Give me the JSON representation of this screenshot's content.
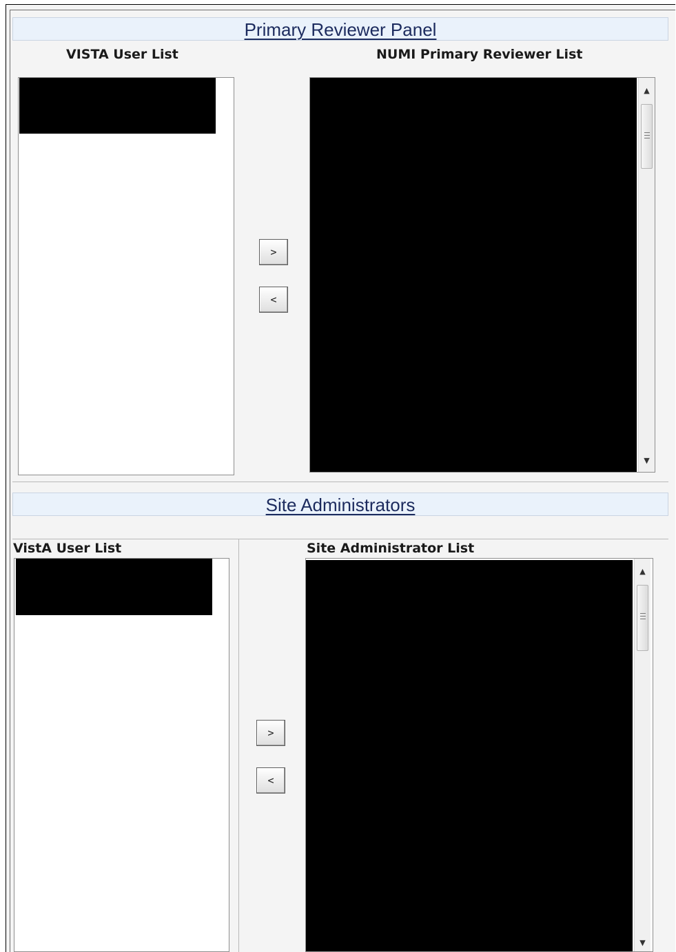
{
  "primary_panel": {
    "title": "Primary Reviewer Panel",
    "left_label": "VISTA User List",
    "right_label": "NUMI Primary Reviewer List",
    "add_button": ">",
    "remove_button": "<"
  },
  "site_admin_panel": {
    "title": "Site Administrators",
    "left_label": "VistA User List",
    "right_label": "Site Administrator List",
    "add_button": ">",
    "remove_button": "<"
  },
  "icons": {
    "scroll_up": "▲",
    "scroll_down": "▼"
  },
  "colors": {
    "header_bg": "#eaf2fb",
    "header_text": "#1c2b5e",
    "panel_bg": "#f4f4f4",
    "redaction": "#000000"
  }
}
